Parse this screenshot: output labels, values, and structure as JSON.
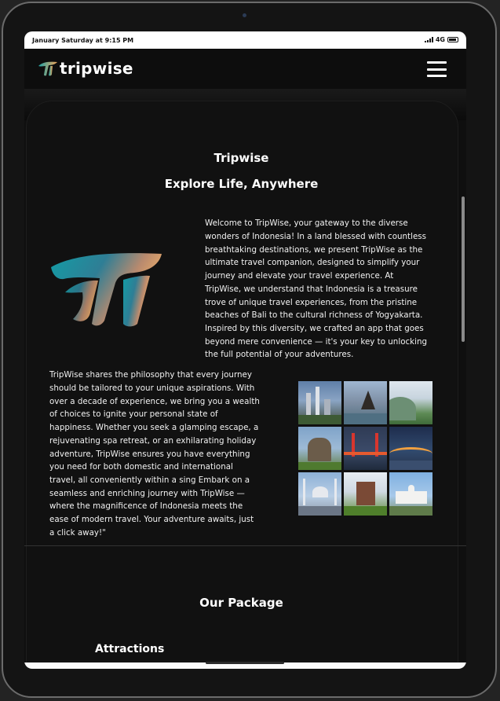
{
  "status_bar": {
    "time": "January Saturday at 9:15 PM",
    "network": "4G"
  },
  "navbar": {
    "brand": "tripwise",
    "menu_icon": "hamburger-menu-icon"
  },
  "hero": {
    "brand_title": "Tripwise",
    "tagline": "Explore Life, Anywhere",
    "intro_paragraph": "Welcome to TripWise, your gateway to the diverse wonders of Indonesia! In a land blessed with countless breathtaking destinations, we present TripWise as the ultimate travel companion, designed to simplify your journey and elevate your travel experience. At TripWise, we understand that Indonesia is a treasure trove of unique travel experiences, from the pristine beaches of Bali to the cultural richness of Yogyakarta. Inspired by this diversity, we crafted an app that goes beyond mere convenience — it's your key to unlocking the full potential of your adventures.",
    "philosophy_paragraph": "TripWise shares the philosophy that every journey should be tailored to your unique aspirations. With over a decade of experience, we bring you a wealth of choices to ignite your personal state of happiness. Whether you seek a glamping escape, a rejuvenating spa retreat, or an exhilarating holiday adventure, TripWise ensures you have everything you need for both domestic and international travel, all conveniently within a sing Embark on a seamless and enriching journey with TripWise — where the magnificence of Indonesia meets the ease of modern travel. Your adventure awaits, just a click away!\""
  },
  "packages": {
    "section_title": "Our Package",
    "subsection_title": "Attractions"
  },
  "colors": {
    "background": "#111111",
    "text": "#ffffff",
    "logo_teal": "#1fa3a6",
    "logo_orange": "#f0a45a"
  }
}
